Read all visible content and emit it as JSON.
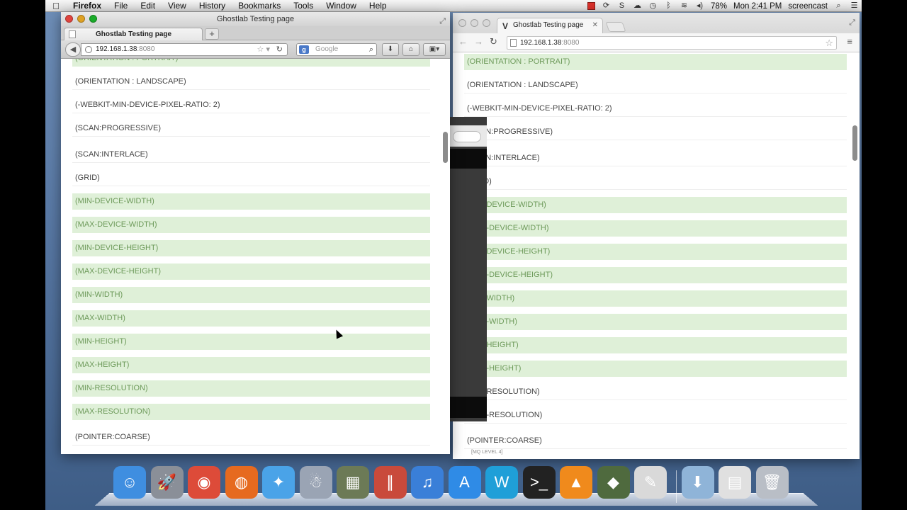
{
  "menubar": {
    "apple": "",
    "items": [
      "Firefox",
      "File",
      "Edit",
      "View",
      "History",
      "Bookmarks",
      "Tools",
      "Window",
      "Help"
    ],
    "battery": "78%",
    "clock": "Mon 2:41 PM",
    "user": "screencast"
  },
  "firefox": {
    "window_title": "Ghostlab Testing page",
    "tab_title": "Ghostlab Testing page",
    "url_host": "192.168.1.38",
    "url_port": ":8080",
    "search_placeholder": "Google",
    "rows": [
      {
        "label": "(ORIENTATION : PORTRAIT)",
        "match": true
      },
      {
        "label": "(ORIENTATION : LANDSCAPE)",
        "match": false
      },
      {
        "label": "(-WEBKIT-MIN-DEVICE-PIXEL-RATIO: 2)",
        "match": false
      },
      {
        "label": "(SCAN:PROGRESSIVE)",
        "match": false
      },
      {
        "label": "(SCAN:INTERLACE)",
        "match": false
      },
      {
        "label": "(GRID)",
        "match": false
      },
      {
        "label": "(MIN-DEVICE-WIDTH)",
        "match": true
      },
      {
        "label": "(MAX-DEVICE-WIDTH)",
        "match": true
      },
      {
        "label": "(MIN-DEVICE-HEIGHT)",
        "match": true
      },
      {
        "label": "(MAX-DEVICE-HEIGHT)",
        "match": true
      },
      {
        "label": "(MIN-WIDTH)",
        "match": true
      },
      {
        "label": "(MAX-WIDTH)",
        "match": true
      },
      {
        "label": "(MIN-HEIGHT)",
        "match": true
      },
      {
        "label": "(MAX-HEIGHT)",
        "match": true
      },
      {
        "label": "(MIN-RESOLUTION)",
        "match": true
      },
      {
        "label": "(MAX-RESOLUTION)",
        "match": true
      },
      {
        "label": "(POINTER:COARSE)",
        "match": false
      }
    ]
  },
  "chrome": {
    "tab_title": "Ghostlab Testing page",
    "favicon": "V",
    "url_host": "192.168.1.38",
    "url_port": ":8080",
    "rows": [
      {
        "label": "(ORIENTATION : PORTRAIT)",
        "match": true
      },
      {
        "label": "(ORIENTATION : LANDSCAPE)",
        "match": false
      },
      {
        "label": "(-WEBKIT-MIN-DEVICE-PIXEL-RATIO: 2)",
        "match": false
      },
      {
        "label": "(SCAN:PROGRESSIVE)",
        "match": false
      },
      {
        "label": "(SCAN:INTERLACE)",
        "match": false
      },
      {
        "label": "(GRID)",
        "match": false
      },
      {
        "label": "(MIN-DEVICE-WIDTH)",
        "match": true
      },
      {
        "label": "(MAX-DEVICE-WIDTH)",
        "match": true
      },
      {
        "label": "(MIN-DEVICE-HEIGHT)",
        "match": true
      },
      {
        "label": "(MAX-DEVICE-HEIGHT)",
        "match": true
      },
      {
        "label": "(MIN-WIDTH)",
        "match": true
      },
      {
        "label": "(MAX-WIDTH)",
        "match": true
      },
      {
        "label": "(MIN-HEIGHT)",
        "match": true
      },
      {
        "label": "(MAX-HEIGHT)",
        "match": true
      },
      {
        "label": "(MIN-RESOLUTION)",
        "match": false
      },
      {
        "label": "(MAX-RESOLUTION)",
        "match": false
      },
      {
        "label": "(POINTER:COARSE)",
        "match": false
      }
    ],
    "footer_label": "[MQ LEVEL 4]"
  },
  "colors": {
    "match_bg": "#dff0d8",
    "match_text": "#6d9a5a",
    "desktop": "#5a7aa6"
  },
  "dock": {
    "apps": [
      {
        "name": "finder",
        "color": "#3f8ee0",
        "glyph": "☺"
      },
      {
        "name": "launchpad",
        "color": "#8a8f98",
        "glyph": "🚀"
      },
      {
        "name": "chrome",
        "color": "#dd4b39",
        "glyph": "◉"
      },
      {
        "name": "firefox",
        "color": "#e66a1f",
        "glyph": "◍"
      },
      {
        "name": "safari",
        "color": "#4aa3e8",
        "glyph": "✦"
      },
      {
        "name": "ghostlab",
        "color": "#9aa4b4",
        "glyph": "☃"
      },
      {
        "name": "photo-browser",
        "color": "#6c7a56",
        "glyph": "▦"
      },
      {
        "name": "parallels",
        "color": "#c94a3b",
        "glyph": "∥"
      },
      {
        "name": "itunes",
        "color": "#3a7fd8",
        "glyph": "♫"
      },
      {
        "name": "app-store",
        "color": "#2f8be6",
        "glyph": "A"
      },
      {
        "name": "coda",
        "color": "#1f9fd8",
        "glyph": "W"
      },
      {
        "name": "terminal",
        "color": "#222222",
        "glyph": ">_"
      },
      {
        "name": "vlc",
        "color": "#f08a1c",
        "glyph": "▲"
      },
      {
        "name": "colorsync",
        "color": "#4f6a3e",
        "glyph": "◆"
      },
      {
        "name": "textedit",
        "color": "#d9d9d9",
        "glyph": "✎"
      }
    ],
    "right": [
      {
        "name": "downloads-folder",
        "color": "#8fb4d8",
        "glyph": "⬇"
      },
      {
        "name": "documents-stack",
        "color": "#e0e0e0",
        "glyph": "▤"
      },
      {
        "name": "trash",
        "color": "#b9bec6",
        "glyph": "🗑"
      }
    ]
  }
}
